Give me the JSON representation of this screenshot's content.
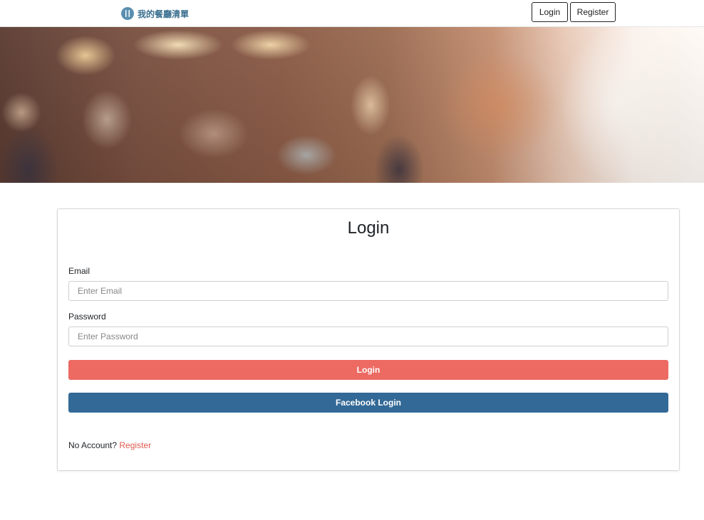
{
  "navbar": {
    "brand_text": "我的餐廳清單",
    "brand_icon": "fork-knife-icon",
    "login_label": "Login",
    "register_label": "Register"
  },
  "hero": {
    "image": "blurred-restaurant-background"
  },
  "login_form": {
    "title": "Login",
    "email_label": "Email",
    "email_placeholder": "Enter Email",
    "email_value": "",
    "password_label": "Password",
    "password_placeholder": "Enter Password",
    "password_value": "",
    "login_button": "Login",
    "facebook_button": "Facebook Login",
    "no_account_text": "No Account?",
    "register_link": "Register"
  },
  "colors": {
    "login_button": "#ec6a62",
    "facebook_button": "#336996",
    "register_link": "#e0574e",
    "brand": "#3a6f8f"
  }
}
